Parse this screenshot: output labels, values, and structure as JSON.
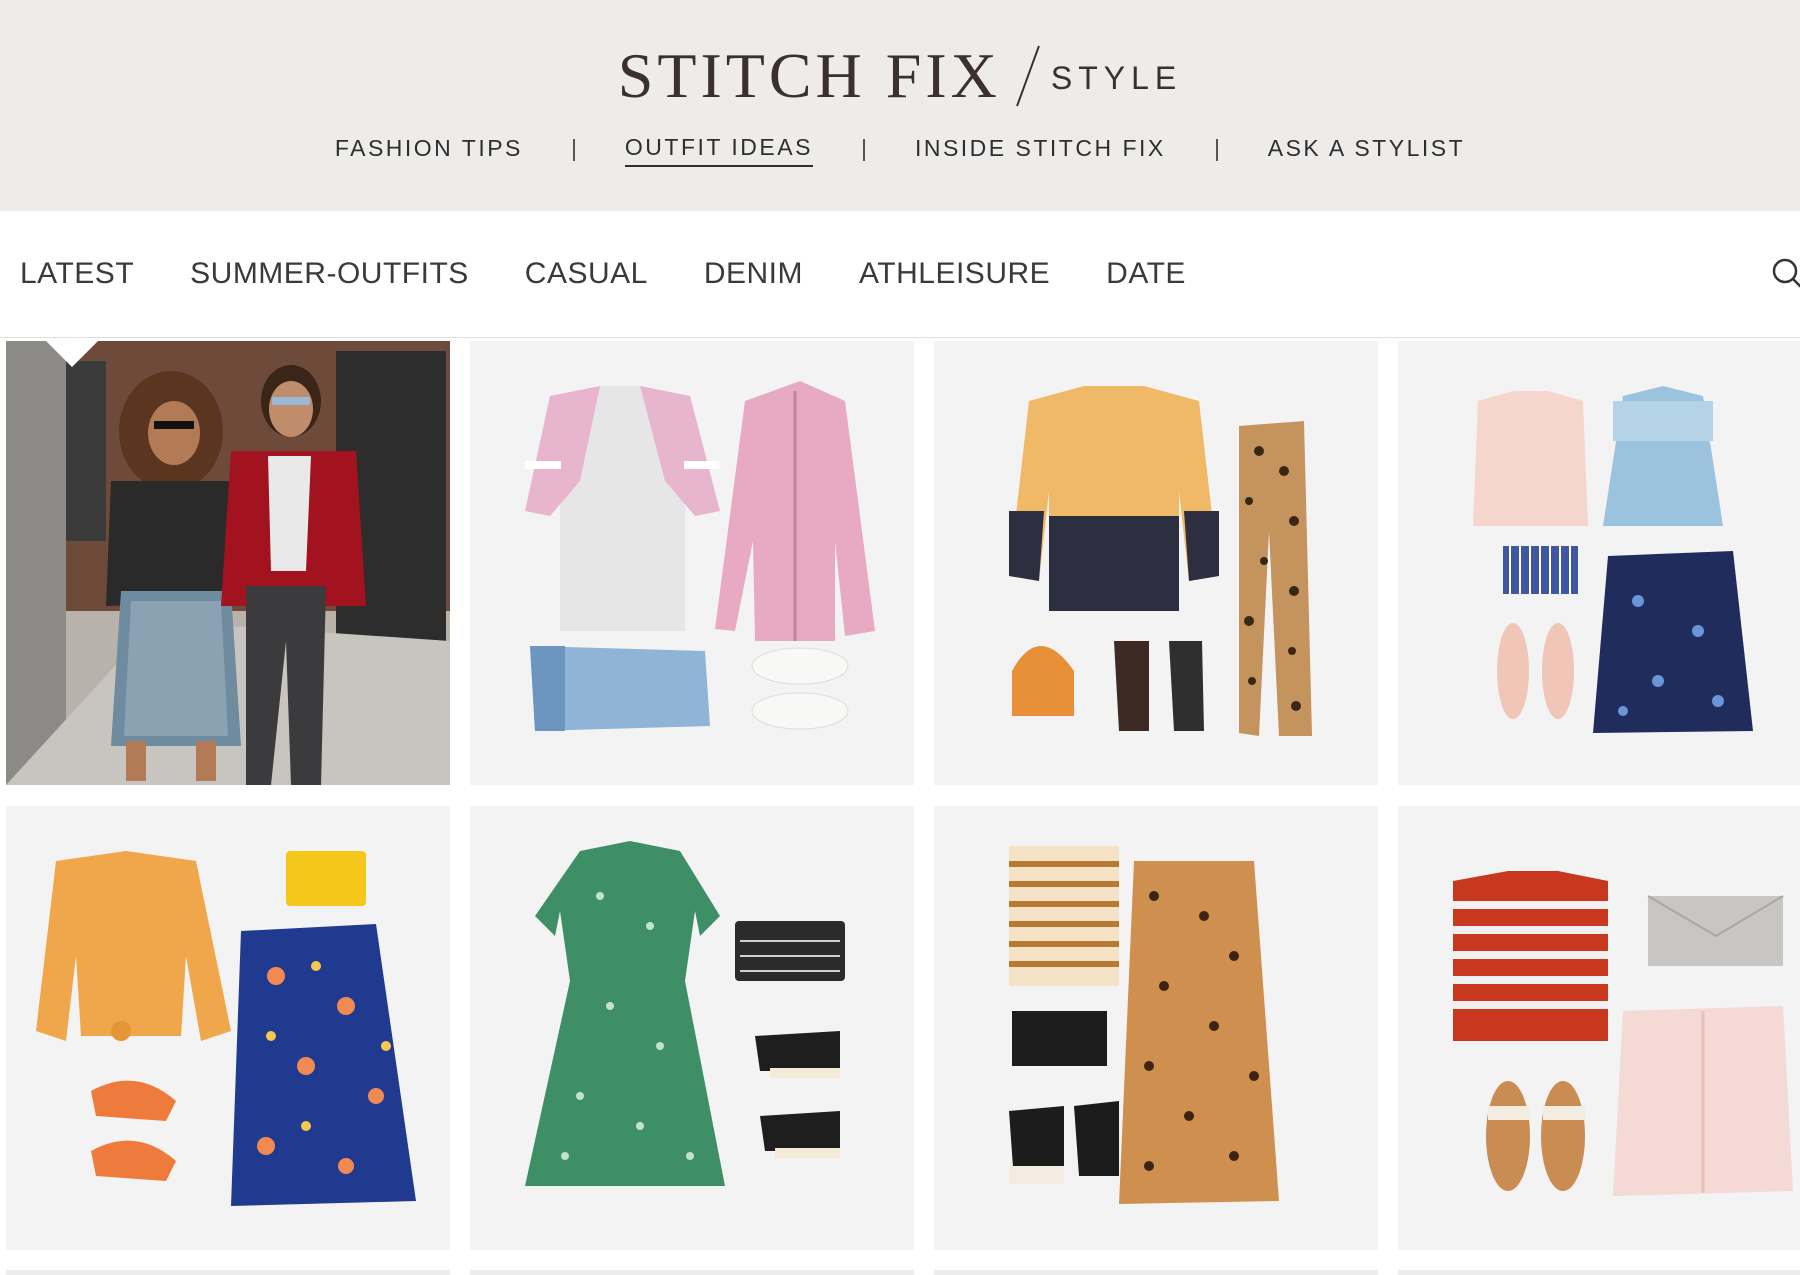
{
  "header": {
    "logo_main": "STITCH FIX",
    "logo_sub": "STYLE",
    "nav": [
      {
        "label": "FASHION TIPS",
        "active": false
      },
      {
        "label": "OUTFIT IDEAS",
        "active": true
      },
      {
        "label": "INSIDE STITCH FIX",
        "active": false
      },
      {
        "label": "ASK A STYLIST",
        "active": false
      }
    ]
  },
  "categories": {
    "items": [
      "LATEST",
      "SUMMER-OUTFITS",
      "CASUAL",
      "DENIM",
      "ATHLEISURE",
      "DATE"
    ],
    "search_icon": "search-icon"
  },
  "colors": {
    "banner_bg": "#edecea",
    "logo_text": "#3a3030",
    "tile_bg": "#f4f4f4"
  },
  "tiles": [
    {
      "subject": "street-photo-two-women"
    },
    {
      "subject": "raglan-tee-pink-jacket-jeans-sneakers"
    },
    {
      "subject": "colorblock-sweater-leopard-pants-bag-boots"
    },
    {
      "subject": "pink-tee-denim-jacket-floral-skirt-sandals"
    },
    {
      "subject": "yellow-blouse-floral-skirt-mules-clutch"
    },
    {
      "subject": "green-dress-clutch-wedges"
    },
    {
      "subject": "striped-tee-leopard-skirt-clutch-mules"
    },
    {
      "subject": "red-striped-tee-pink-denim-skirt-sandals"
    }
  ]
}
